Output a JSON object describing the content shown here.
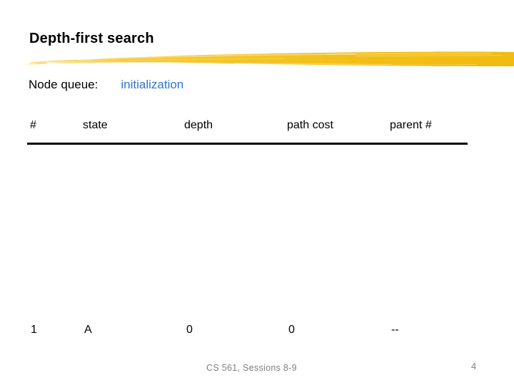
{
  "slide": {
    "title": "Depth-first search",
    "accent_color": "#F5C029",
    "link_color": "#2E75C8",
    "footer_color": "#7F7F7F",
    "background_color": "#FFFFFF",
    "decorations": {
      "brush_stroke": "yellow-brush-stroke",
      "rule": "horizontal-rule"
    }
  },
  "queue": {
    "label": "Node queue:",
    "value": "initialization"
  },
  "table": {
    "headers": [
      "#",
      "state",
      "depth",
      "path cost",
      "parent #"
    ],
    "rows": [
      [
        "1",
        "A",
        "0",
        "0",
        "--"
      ]
    ]
  },
  "footer": {
    "course": "CS 561, Sessions 8-9",
    "page": "4"
  }
}
